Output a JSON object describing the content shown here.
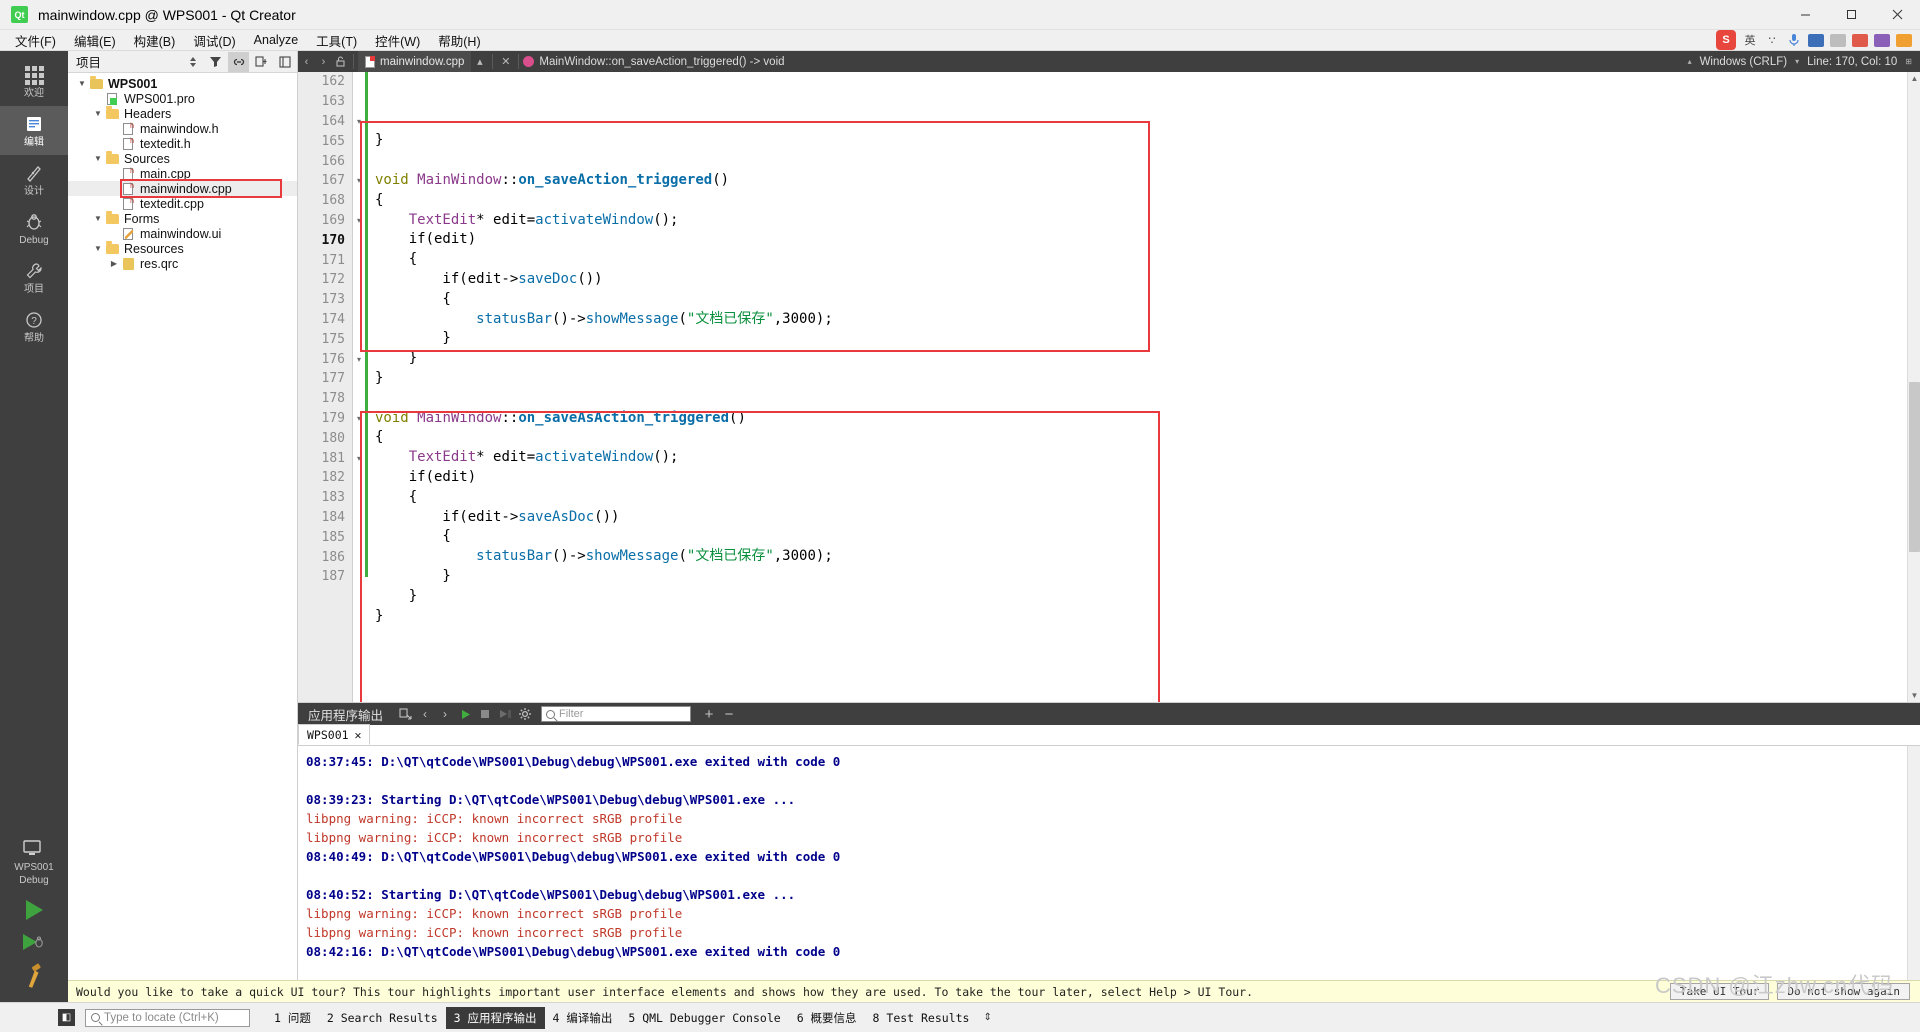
{
  "window": {
    "title": "mainwindow.cpp @ WPS001 - Qt Creator",
    "logo_text": "Qt",
    "minimize": "–",
    "maximize": "□",
    "close": "✕"
  },
  "menubar": {
    "items": [
      {
        "label": "文件(F)",
        "name": "menu-file"
      },
      {
        "label": "编辑(E)",
        "name": "menu-edit"
      },
      {
        "label": "构建(B)",
        "name": "menu-build"
      },
      {
        "label": "调试(D)",
        "name": "menu-debug"
      },
      {
        "label": "Analyze",
        "name": "menu-analyze"
      },
      {
        "label": "工具(T)",
        "name": "menu-tools"
      },
      {
        "label": "控件(W)",
        "name": "menu-window"
      },
      {
        "label": "帮助(H)",
        "name": "menu-help"
      }
    ]
  },
  "tray": {
    "sogou_label": "S",
    "ime_label": "英",
    "items": [
      "∵",
      "♪",
      "⌨",
      "▭",
      "✂",
      "🅐",
      "⊞"
    ]
  },
  "modebar": {
    "items": [
      {
        "label": "欢迎",
        "icon": "grid-icon",
        "selected": false
      },
      {
        "label": "编辑",
        "icon": "pencil-edit-icon",
        "selected": true
      },
      {
        "label": "设计",
        "icon": "ruler-design-icon",
        "selected": false
      },
      {
        "label": "Debug",
        "icon": "bug-debug-icon",
        "selected": false
      },
      {
        "label": "项目",
        "icon": "wrench-projects-icon",
        "selected": false
      },
      {
        "label": "帮助",
        "icon": "help-question-icon",
        "selected": false
      }
    ],
    "kit": {
      "label": "WPS001",
      "sub": "Debug"
    }
  },
  "project_panel": {
    "title": "项目",
    "header_buttons": [
      "sort-filter-icon",
      "filter-icon",
      "link-sync-icon",
      "split-icon",
      "close-icon"
    ],
    "tree": [
      {
        "label": "WPS001",
        "depth": 0,
        "arrow": "▼",
        "icon": "qt-project-folder-icon",
        "bold": true,
        "selected": false
      },
      {
        "label": "WPS001.pro",
        "depth": 1,
        "arrow": "",
        "icon": "pro-file-icon",
        "bold": false,
        "selected": false
      },
      {
        "label": "Headers",
        "depth": 1,
        "arrow": "▼",
        "icon": "headers-folder-icon",
        "bold": false,
        "selected": false
      },
      {
        "label": "mainwindow.h",
        "depth": 2,
        "arrow": "",
        "icon": "header-file-icon",
        "bold": false,
        "selected": false
      },
      {
        "label": "textedit.h",
        "depth": 2,
        "arrow": "",
        "icon": "header-file-icon",
        "bold": false,
        "selected": false
      },
      {
        "label": "Sources",
        "depth": 1,
        "arrow": "▼",
        "icon": "sources-folder-icon",
        "bold": false,
        "selected": false
      },
      {
        "label": "main.cpp",
        "depth": 2,
        "arrow": "",
        "icon": "cpp-file-icon",
        "bold": false,
        "selected": false
      },
      {
        "label": "mainwindow.cpp",
        "depth": 2,
        "arrow": "",
        "icon": "cpp-file-icon",
        "bold": false,
        "selected": true
      },
      {
        "label": "textedit.cpp",
        "depth": 2,
        "arrow": "",
        "icon": "cpp-file-icon",
        "bold": false,
        "selected": false
      },
      {
        "label": "Forms",
        "depth": 1,
        "arrow": "▼",
        "icon": "forms-folder-icon",
        "bold": false,
        "selected": false
      },
      {
        "label": "mainwindow.ui",
        "depth": 2,
        "arrow": "",
        "icon": "ui-file-icon",
        "bold": false,
        "selected": false
      },
      {
        "label": "Resources",
        "depth": 1,
        "arrow": "▼",
        "icon": "resources-folder-icon",
        "bold": false,
        "selected": false
      },
      {
        "label": "res.qrc",
        "depth": 2,
        "arrow": "▶",
        "icon": "qrc-file-icon",
        "bold": false,
        "selected": false
      }
    ]
  },
  "editor": {
    "tab_name": "mainwindow.cpp",
    "symbol": "MainWindow::on_saveAction_triggered() -> void",
    "line_ending": "Windows (CRLF)",
    "cursor": "Line: 170, Col: 10",
    "first_line": 162,
    "current_line": 170,
    "lines": [
      {
        "n": 162,
        "fold": "",
        "tokens": [
          {
            "t": "}",
            "c": "op"
          }
        ]
      },
      {
        "n": 163,
        "fold": "",
        "tokens": []
      },
      {
        "n": 164,
        "fold": "▾",
        "tokens": [
          {
            "t": "void ",
            "c": "k"
          },
          {
            "t": "MainWindow",
            "c": "cls"
          },
          {
            "t": "::",
            "c": "op"
          },
          {
            "t": "on_saveAction_triggered",
            "c": "fn"
          },
          {
            "t": "()",
            "c": "op"
          }
        ]
      },
      {
        "n": 165,
        "fold": "",
        "tokens": [
          {
            "t": "{",
            "c": "op"
          }
        ]
      },
      {
        "n": 166,
        "fold": "",
        "tokens": [
          {
            "t": "    ",
            "c": "op"
          },
          {
            "t": "TextEdit",
            "c": "typ"
          },
          {
            "t": "* edit=",
            "c": "op"
          },
          {
            "t": "activateWindow",
            "c": "fnp"
          },
          {
            "t": "();",
            "c": "op"
          }
        ]
      },
      {
        "n": 167,
        "fold": "▾",
        "tokens": [
          {
            "t": "    if(edit)",
            "c": "op"
          }
        ]
      },
      {
        "n": 168,
        "fold": "",
        "tokens": [
          {
            "t": "    {",
            "c": "op"
          }
        ]
      },
      {
        "n": 169,
        "fold": "▾",
        "tokens": [
          {
            "t": "        if(edit->",
            "c": "op"
          },
          {
            "t": "saveDoc",
            "c": "fnp"
          },
          {
            "t": "())",
            "c": "op"
          }
        ]
      },
      {
        "n": 170,
        "fold": "",
        "tokens": [
          {
            "t": "        {",
            "c": "op"
          }
        ]
      },
      {
        "n": 171,
        "fold": "",
        "tokens": [
          {
            "t": "            ",
            "c": "op"
          },
          {
            "t": "statusBar",
            "c": "fnp"
          },
          {
            "t": "()->",
            "c": "op"
          },
          {
            "t": "showMessage",
            "c": "fnp"
          },
          {
            "t": "(",
            "c": "op"
          },
          {
            "t": "\"文档已保存\"",
            "c": "str"
          },
          {
            "t": ",3000);",
            "c": "op"
          }
        ]
      },
      {
        "n": 172,
        "fold": "",
        "tokens": [
          {
            "t": "        }",
            "c": "op"
          }
        ]
      },
      {
        "n": 173,
        "fold": "",
        "tokens": [
          {
            "t": "    }",
            "c": "op"
          }
        ]
      },
      {
        "n": 174,
        "fold": "",
        "tokens": [
          {
            "t": "}",
            "c": "op"
          }
        ]
      },
      {
        "n": 175,
        "fold": "",
        "tokens": []
      },
      {
        "n": 176,
        "fold": "▾",
        "tokens": [
          {
            "t": "void ",
            "c": "k"
          },
          {
            "t": "MainWindow",
            "c": "cls"
          },
          {
            "t": "::",
            "c": "op"
          },
          {
            "t": "on_saveAsAction_triggered",
            "c": "fn"
          },
          {
            "t": "()",
            "c": "op"
          }
        ]
      },
      {
        "n": 177,
        "fold": "",
        "tokens": [
          {
            "t": "{",
            "c": "op"
          }
        ]
      },
      {
        "n": 178,
        "fold": "",
        "tokens": [
          {
            "t": "    ",
            "c": "op"
          },
          {
            "t": "TextEdit",
            "c": "typ"
          },
          {
            "t": "* edit=",
            "c": "op"
          },
          {
            "t": "activateWindow",
            "c": "fnp"
          },
          {
            "t": "();",
            "c": "op"
          }
        ]
      },
      {
        "n": 179,
        "fold": "▾",
        "tokens": [
          {
            "t": "    if(edit)",
            "c": "op"
          }
        ]
      },
      {
        "n": 180,
        "fold": "",
        "tokens": [
          {
            "t": "    {",
            "c": "op"
          }
        ]
      },
      {
        "n": 181,
        "fold": "▾",
        "tokens": [
          {
            "t": "        if(edit->",
            "c": "op"
          },
          {
            "t": "saveAsDoc",
            "c": "fnp"
          },
          {
            "t": "())",
            "c": "op"
          }
        ]
      },
      {
        "n": 182,
        "fold": "",
        "tokens": [
          {
            "t": "        {",
            "c": "op"
          }
        ]
      },
      {
        "n": 183,
        "fold": "",
        "tokens": [
          {
            "t": "            ",
            "c": "op"
          },
          {
            "t": "statusBar",
            "c": "fnp"
          },
          {
            "t": "()->",
            "c": "op"
          },
          {
            "t": "showMessage",
            "c": "fnp"
          },
          {
            "t": "(",
            "c": "op"
          },
          {
            "t": "\"文档已保存\"",
            "c": "str"
          },
          {
            "t": ",3000);",
            "c": "op"
          }
        ]
      },
      {
        "n": 184,
        "fold": "",
        "tokens": [
          {
            "t": "        }",
            "c": "op"
          }
        ]
      },
      {
        "n": 185,
        "fold": "",
        "tokens": [
          {
            "t": "    }",
            "c": "op"
          }
        ]
      },
      {
        "n": 186,
        "fold": "",
        "tokens": [
          {
            "t": "}",
            "c": "op"
          }
        ]
      },
      {
        "n": 187,
        "fold": "",
        "tokens": []
      }
    ]
  },
  "output_pane": {
    "title": "应用程序输出",
    "filter_placeholder": "Filter",
    "buttons": [
      "open-in-editor-icon",
      "prev-icon",
      "next-icon",
      "run-icon",
      "stop-icon",
      "attach-icon",
      "settings-gear-icon"
    ],
    "zoom_in": "+",
    "zoom_out": "−",
    "tab_label": "WPS001",
    "tab_close": "✕",
    "log": [
      {
        "text": "08:37:45: D:\\QT\\qtCode\\WPS001\\Debug\\debug\\WPS001.exe exited with code 0",
        "style": "n"
      },
      {
        "text": "",
        "style": "plain"
      },
      {
        "text": "08:39:23: Starting D:\\QT\\qtCode\\WPS001\\Debug\\debug\\WPS001.exe ...",
        "style": "n"
      },
      {
        "text": "libpng warning: iCCP: known incorrect sRGB profile",
        "style": "w"
      },
      {
        "text": "libpng warning: iCCP: known incorrect sRGB profile",
        "style": "w"
      },
      {
        "text": "08:40:49: D:\\QT\\qtCode\\WPS001\\Debug\\debug\\WPS001.exe exited with code 0",
        "style": "n"
      },
      {
        "text": "",
        "style": "plain"
      },
      {
        "text": "08:40:52: Starting D:\\QT\\qtCode\\WPS001\\Debug\\debug\\WPS001.exe ...",
        "style": "b"
      },
      {
        "text": "libpng warning: iCCP: known incorrect sRGB profile",
        "style": "w"
      },
      {
        "text": "libpng warning: iCCP: known incorrect sRGB profile",
        "style": "w"
      },
      {
        "text": "08:42:16: D:\\QT\\qtCode\\WPS001\\Debug\\debug\\WPS001.exe exited with code 0",
        "style": "b"
      }
    ]
  },
  "tour": {
    "message": "Would you like to take a quick UI tour? This tour highlights important user interface elements and shows how they are used. To take the tour later, select Help > UI Tour.",
    "take_tour": "Take UI Tour",
    "dismiss": "Do not show again"
  },
  "statusbar": {
    "locate_placeholder": "Type to locate (Ctrl+K)",
    "items": [
      {
        "num": "1",
        "label": "问题",
        "active": false
      },
      {
        "num": "2",
        "label": "Search Results",
        "active": false
      },
      {
        "num": "3",
        "label": "应用程序输出",
        "active": true
      },
      {
        "num": "4",
        "label": "编译输出",
        "active": false
      },
      {
        "num": "5",
        "label": "QML Debugger Console",
        "active": false
      },
      {
        "num": "6",
        "label": "概要信息",
        "active": false
      },
      {
        "num": "8",
        "label": "Test Results",
        "active": false
      }
    ]
  },
  "watermark": {
    "text": "CSDN @江zhw.cn代码"
  },
  "colors": {
    "accent": "#41cd52",
    "highlight_box": "#e8393c",
    "dark_chrome": "#403f3f"
  }
}
